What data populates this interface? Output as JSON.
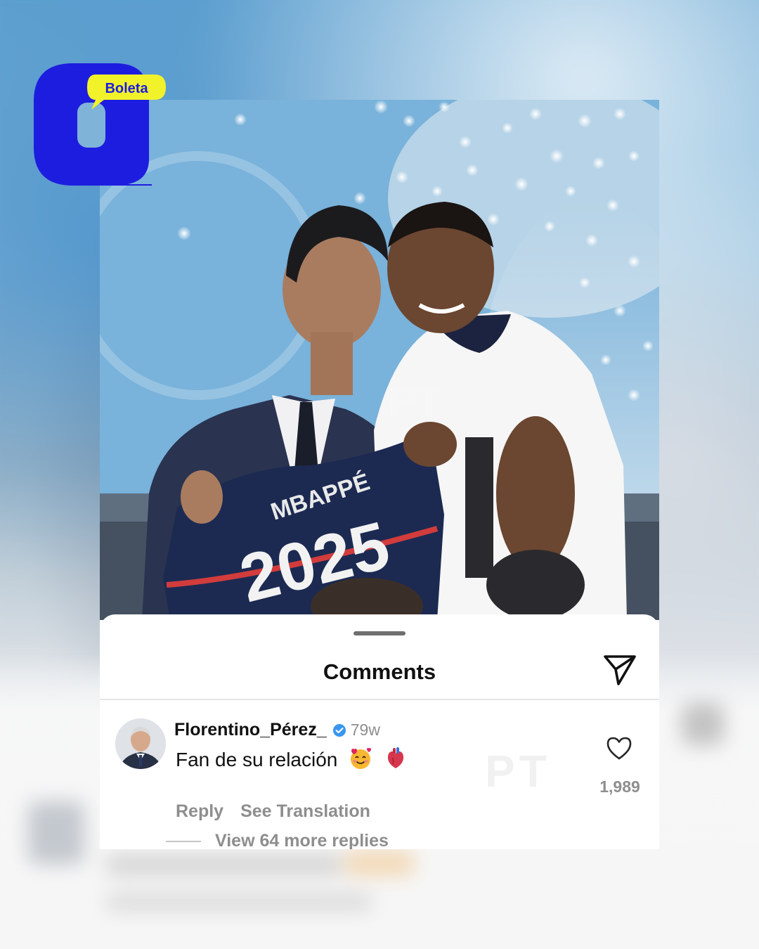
{
  "logo": {
    "text": "Boleta",
    "accent": "#1d1de0",
    "bubble": "#f2f22a"
  },
  "photo": {
    "jersey_name": "MBAPPÉ",
    "jersey_number": "2025",
    "watermark": "PT"
  },
  "comments_sheet": {
    "title": "Comments",
    "send_icon": "send-icon",
    "comment": {
      "username": "Florentino_Pérez_",
      "verified": true,
      "timestamp": "79w",
      "text": "Fan de su relación",
      "emojis": [
        "smiling-face-with-hearts",
        "anatomical-heart"
      ],
      "reply_label": "Reply",
      "translate_label": "See Translation",
      "like_icon": "heart-icon",
      "like_count": "1,989",
      "more_replies": "View 64 more replies",
      "watermark": "PT"
    }
  },
  "colors": {
    "verified": "#3897f0",
    "muted": "#8e8e8e",
    "text": "#111111"
  }
}
